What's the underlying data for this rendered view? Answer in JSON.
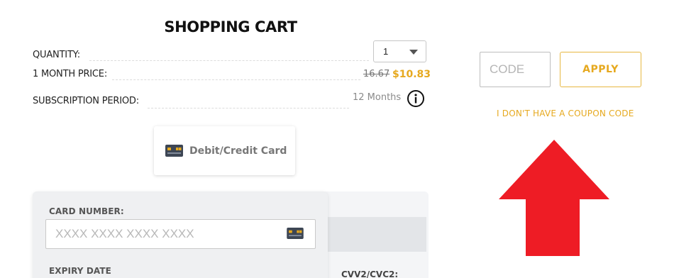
{
  "cart": {
    "title": "SHOPPING CART",
    "quantity_label": "QUANTITY:",
    "quantity_value": "1",
    "price_label": "1 MONTH PRICE:",
    "old_price": "16.67",
    "new_price": "$10.83",
    "period_label": "SUBSCRIPTION PERIOD:",
    "period_value": "12 Months"
  },
  "payment": {
    "method_label": "Debit/Credit Card",
    "card_number_label": "CARD NUMBER:",
    "card_number_placeholder": "XXXX XXXX XXXX XXXX",
    "expiry_label": "EXPIRY DATE",
    "cvv_label": "CVV2/CVC2:"
  },
  "coupon": {
    "code_placeholder": "CODE",
    "apply_label": "APPLY",
    "no_coupon_label": "I DON'T HAVE A COUPON CODE"
  },
  "colors": {
    "accent": "#e6a91f",
    "arrow": "#ee1c25",
    "card_icon": "#3d4654"
  },
  "icons": {
    "info": "info-icon",
    "card": "credit-card-icon",
    "dropdown": "chevron-down-icon",
    "arrow": "arrow-up-icon"
  }
}
